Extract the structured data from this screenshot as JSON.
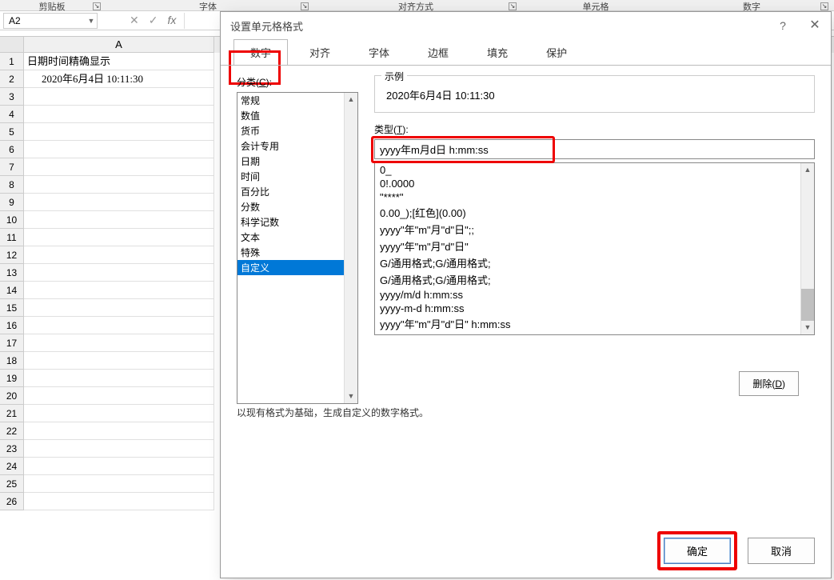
{
  "ribbon": {
    "groups": [
      "剪贴板",
      "字体",
      "对齐方式",
      "单元格",
      "数字"
    ]
  },
  "nameBox": "A2",
  "formulaBtns": {
    "cancel": "✕",
    "confirm": "✓",
    "fx": "fx"
  },
  "columns": [
    "A"
  ],
  "rows": [
    {
      "n": 1,
      "a": "日期时间精确显示"
    },
    {
      "n": 2,
      "a": "2020年6月4日 10:11:30"
    },
    {
      "n": 3,
      "a": ""
    },
    {
      "n": 4,
      "a": ""
    },
    {
      "n": 5,
      "a": ""
    },
    {
      "n": 6,
      "a": ""
    },
    {
      "n": 7,
      "a": ""
    },
    {
      "n": 8,
      "a": ""
    },
    {
      "n": 9,
      "a": ""
    },
    {
      "n": 10,
      "a": ""
    },
    {
      "n": 11,
      "a": ""
    },
    {
      "n": 12,
      "a": ""
    },
    {
      "n": 13,
      "a": ""
    },
    {
      "n": 14,
      "a": ""
    },
    {
      "n": 15,
      "a": ""
    },
    {
      "n": 16,
      "a": ""
    },
    {
      "n": 17,
      "a": ""
    },
    {
      "n": 18,
      "a": ""
    },
    {
      "n": 19,
      "a": ""
    },
    {
      "n": 20,
      "a": ""
    },
    {
      "n": 21,
      "a": ""
    },
    {
      "n": 22,
      "a": ""
    },
    {
      "n": 23,
      "a": ""
    },
    {
      "n": 24,
      "a": ""
    },
    {
      "n": 25,
      "a": ""
    },
    {
      "n": 26,
      "a": ""
    }
  ],
  "dialog": {
    "title": "设置单元格格式",
    "help": "?",
    "close": "✕",
    "tabs": [
      "数字",
      "对齐",
      "字体",
      "边框",
      "填充",
      "保护"
    ],
    "activeTabIndex": 0,
    "categoryLabelPrefix": "分类(",
    "categoryLabelHotkey": "C",
    "categoryLabelSuffix": "):",
    "categories": [
      "常规",
      "数值",
      "货币",
      "会计专用",
      "日期",
      "时间",
      "百分比",
      "分数",
      "科学记数",
      "文本",
      "特殊",
      "自定义"
    ],
    "selectedCategoryIndex": 11,
    "exampleLabel": "示例",
    "exampleValue": "2020年6月4日 10:11:30",
    "typeLabelPrefix": "类型(",
    "typeLabelHotkey": "T",
    "typeLabelSuffix": "):",
    "typeValue": "yyyy年m月d日 h:mm:ss",
    "typeList": [
      "0_",
      "0!.0000",
      "\"****\"",
      "0.00_);[红色](0.00)",
      "yyyy\"年\"m\"月\"d\"日\";;",
      "yyyy\"年\"m\"月\"d\"日\"",
      "G/通用格式;G/通用格式;",
      "G/通用格式;G/通用格式;",
      "yyyy/m/d h:mm:ss",
      "yyyy-m-d h:mm:ss",
      "yyyy\"年\"m\"月\"d\"日\" h:mm:ss"
    ],
    "deletePrefix": "删除(",
    "deleteHotkey": "D",
    "deleteSuffix": ")",
    "hint": "以现有格式为基础，生成自定义的数字格式。",
    "ok": "确定",
    "cancel": "取消"
  }
}
